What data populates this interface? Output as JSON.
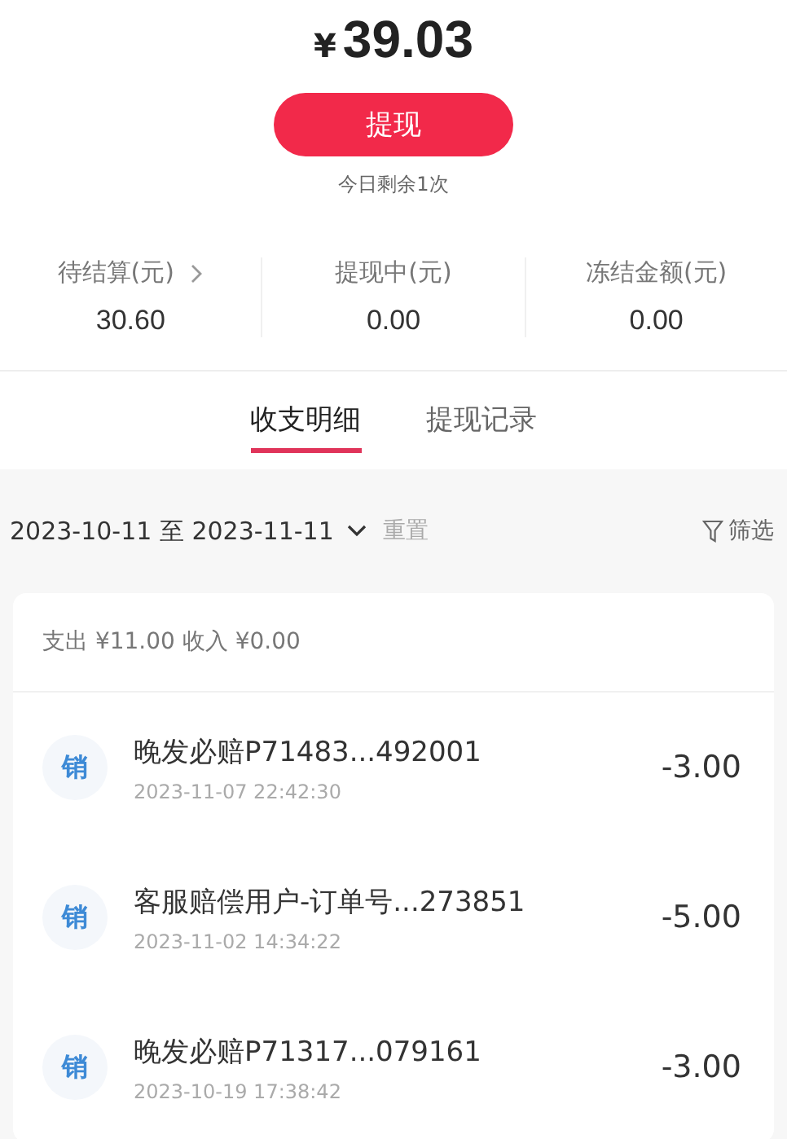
{
  "balance": {
    "currency": "¥",
    "amount": "39.03"
  },
  "withdraw_button": {
    "label": "提现"
  },
  "remaining_note": "今日剩余1次",
  "stats": [
    {
      "label": "待结算(元)",
      "value": "30.60",
      "has_arrow": true
    },
    {
      "label": "提现中(元)",
      "value": "0.00",
      "has_arrow": false
    },
    {
      "label": "冻结金额(元)",
      "value": "0.00",
      "has_arrow": false
    }
  ],
  "tabs": [
    {
      "label": "收支明细",
      "selected": true
    },
    {
      "label": "提现记录",
      "selected": false
    }
  ],
  "filter_bar": {
    "date_range": "2023-10-11 至 2023-11-11",
    "reset": "重置",
    "filter": "筛选"
  },
  "summary": "支出 ¥11.00 收入 ¥0.00",
  "transactions": [
    {
      "badge": "销",
      "title": "晚发必赔P71483...492001",
      "time": "2023-11-07 22:42:30",
      "amount": "-3.00"
    },
    {
      "badge": "销",
      "title": "客服赔偿用户-订单号...273851",
      "time": "2023-11-02 14:34:22",
      "amount": "-5.00"
    },
    {
      "badge": "销",
      "title": "晚发必赔P71317...079161",
      "time": "2023-10-19 17:38:42",
      "amount": "-3.00"
    }
  ]
}
